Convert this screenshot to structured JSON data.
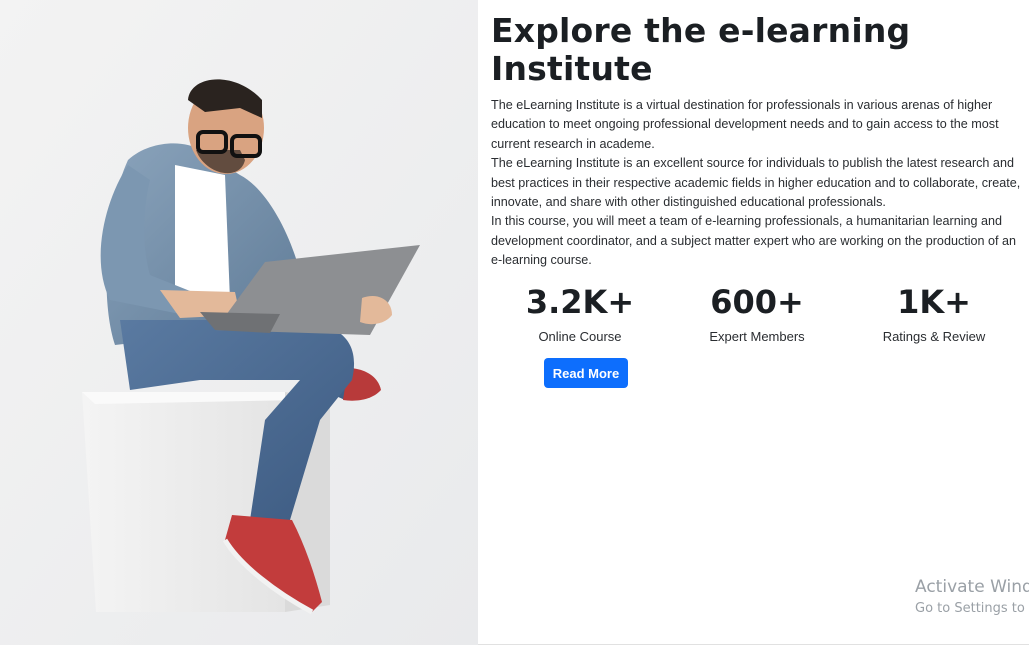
{
  "hero": {
    "title_line1": "Explore the e-learning",
    "title_line2": "Institute",
    "paragraphs": [
      "The eLearning Institute is a virtual destination for professionals in various arenas of higher education to meet ongoing professional development needs and to gain access to the most current research in academe.",
      "The eLearning Institute is an excellent source for individuals to publish the latest research and best practices in their respective academic fields in higher education and to collaborate, create, innovate, and share with other distinguished educational professionals.",
      "In this course, you will meet a team of e-learning professionals, a humanitarian learning and development coordinator, and a subject matter expert who are working on the production of an e-learning course."
    ]
  },
  "stats": [
    {
      "value": "3.2K+",
      "label": "Online Course"
    },
    {
      "value": "600+",
      "label": "Expert Members"
    },
    {
      "value": "1K+",
      "label": "Ratings & Review"
    }
  ],
  "cta": {
    "read_more_label": "Read More",
    "color": "#0d6efd"
  },
  "watermark": {
    "line1": "Activate Windows",
    "line2": "Go to Settings to activate Windows."
  }
}
